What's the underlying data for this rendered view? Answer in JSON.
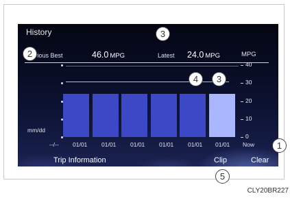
{
  "screen": {
    "title": "History",
    "previous_best": {
      "label": "Previous Best",
      "value": "46.0",
      "unit": "MPG"
    },
    "latest": {
      "label": "Latest",
      "value": "24.0",
      "unit": "MPG"
    },
    "axis_unit": "MPG",
    "y_ticks": [
      "40",
      "30",
      "20",
      "10",
      "0"
    ],
    "y_label": "mm/dd",
    "x_ticks": [
      "--/--",
      "01/01",
      "01/01",
      "01/01",
      "01/01",
      "01/01",
      "01/01",
      "Now"
    ],
    "buttons": {
      "trip_info": "Trip Information",
      "clip": "Clip",
      "clear": "Clear"
    }
  },
  "chart_data": {
    "type": "bar",
    "categories": [
      "01/01",
      "01/01",
      "01/01",
      "01/01",
      "01/01",
      "Now"
    ],
    "values": [
      24,
      24,
      24,
      24,
      24,
      24
    ],
    "ylim": [
      0,
      40
    ],
    "reference_lines": [
      46.0,
      24.0
    ]
  },
  "callouts": [
    "1",
    "2",
    "3",
    "3",
    "4",
    "5"
  ],
  "caption": "CLY20BR227"
}
